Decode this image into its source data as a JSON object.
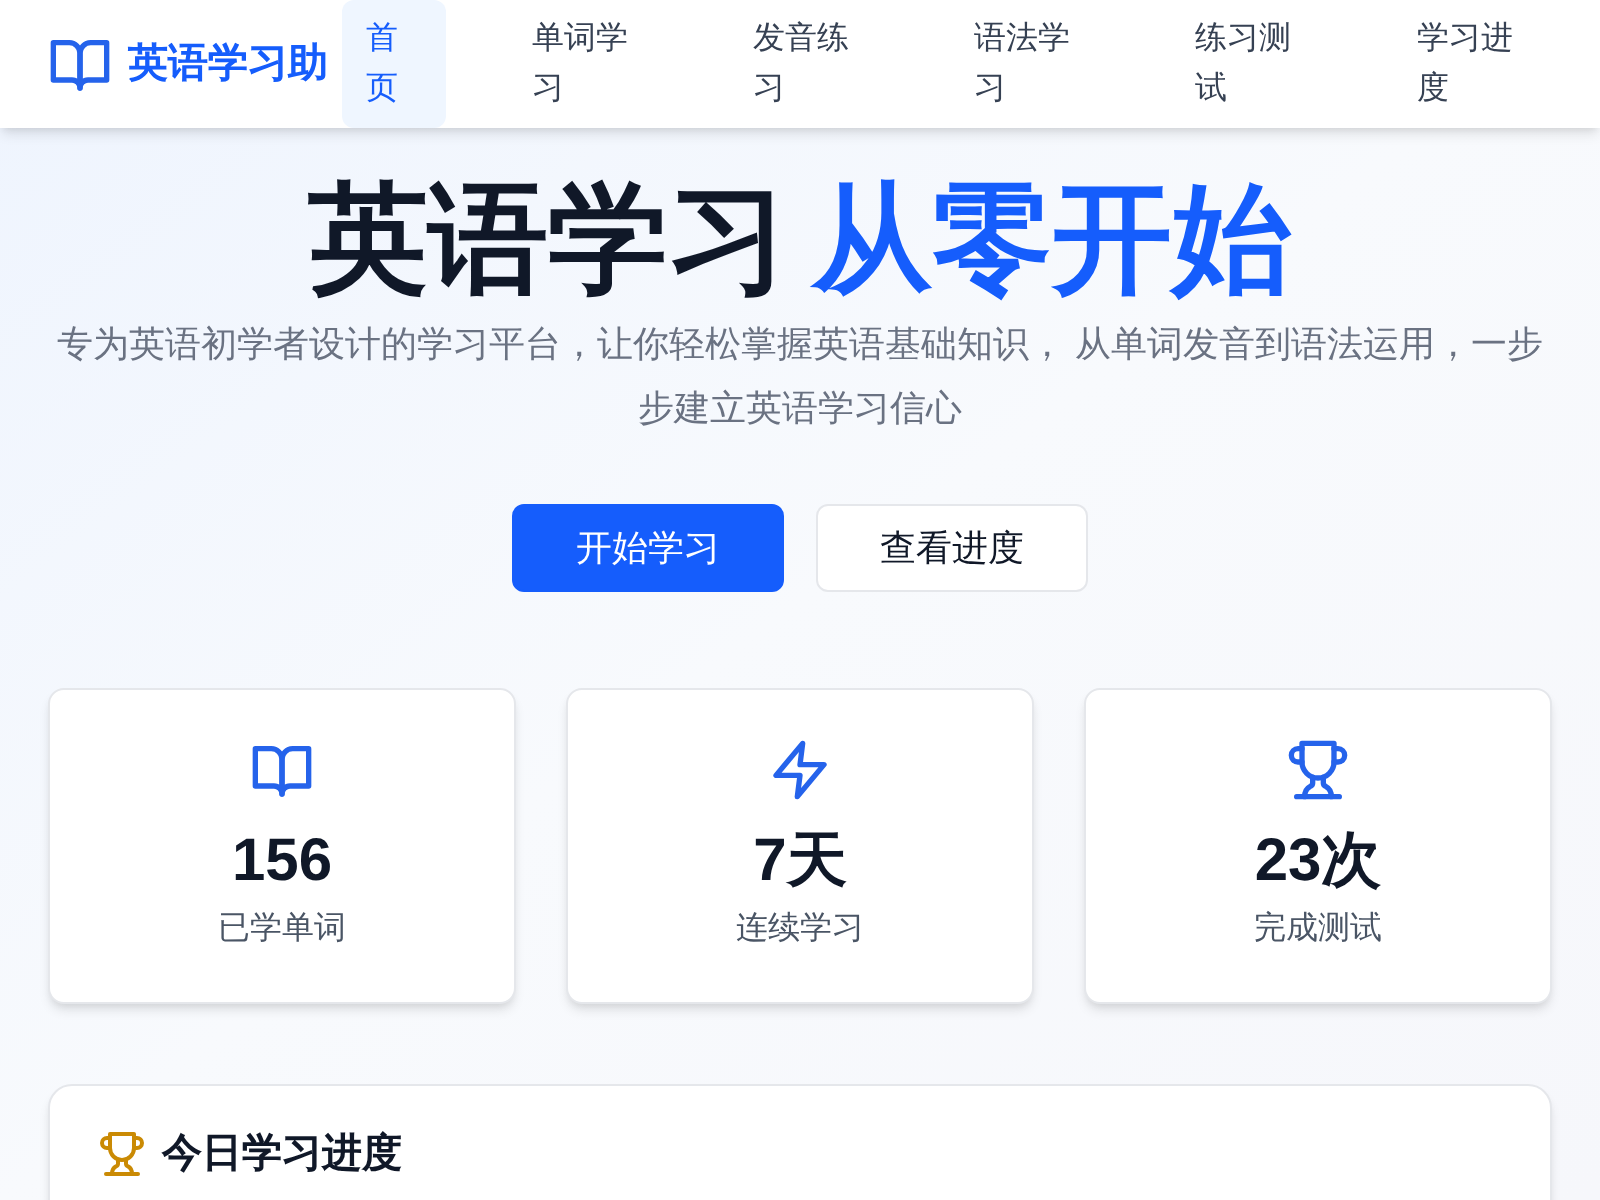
{
  "header": {
    "logo_text": "英语学习助",
    "nav": [
      {
        "label": "首页",
        "selected": true
      },
      {
        "label": "单词学习",
        "selected": false
      },
      {
        "label": "发音练习",
        "selected": false
      },
      {
        "label": "语法学习",
        "selected": false
      },
      {
        "label": "练习测试",
        "selected": false
      },
      {
        "label": "学习进度",
        "selected": false
      }
    ]
  },
  "hero": {
    "title": "英语学习",
    "title_highlight": "从零开始",
    "subtitle": "专为英语初学者设计的学习平台，让你轻松掌握英语基础知识， 从单词发音到语法运用，一步步建立英语学习信心",
    "buttons": [
      {
        "label": "开始学习",
        "kind": "primary"
      },
      {
        "label": "查看进度",
        "kind": "secondary"
      }
    ]
  },
  "stats": [
    {
      "kind": "book",
      "value": "156",
      "label": "已学单词"
    },
    {
      "kind": "bolt",
      "value": "7天",
      "label": "连续学习"
    },
    {
      "kind": "trophy",
      "value": "23次",
      "label": "完成测试"
    }
  ],
  "progress_card": {
    "title": "今日学习进度"
  }
}
